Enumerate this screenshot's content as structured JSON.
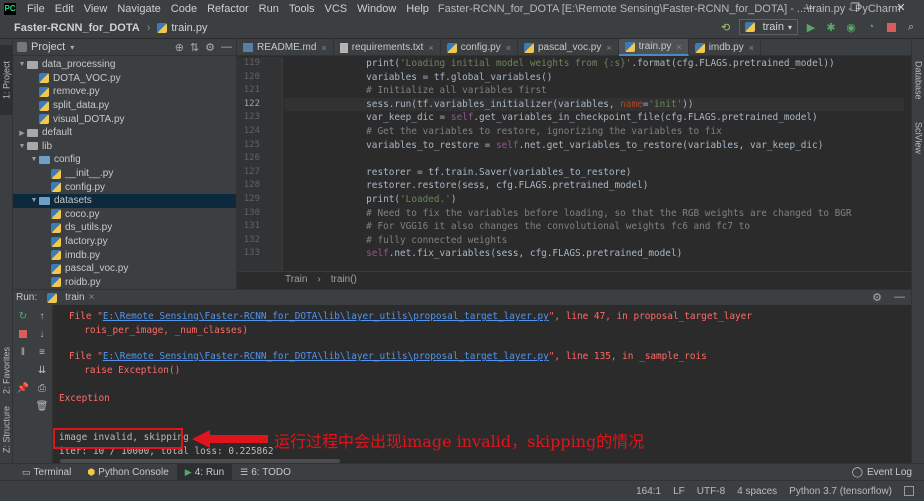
{
  "window": {
    "menu": [
      "File",
      "Edit",
      "View",
      "Navigate",
      "Code",
      "Refactor",
      "Run",
      "Tools",
      "VCS",
      "Window",
      "Help"
    ],
    "title": "Faster-RCNN_for_DOTA [E:\\Remote Sensing\\Faster-RCNN_for_DOTA] - ...\\train.py - PyCharm",
    "controls": [
      "—",
      "❐",
      "✕"
    ]
  },
  "navbar": {
    "project": "Faster-RCNN_for_DOTA",
    "file": "train.py",
    "run_config": "train"
  },
  "left_stripe": {
    "project_tab": "1: Project",
    "favorites_tab": "2: Favorites",
    "structure_tab": "Z: Structure"
  },
  "right_stripe": {
    "database_tab": "Database",
    "sciview_tab": "SciView"
  },
  "project_panel": {
    "title": "Project",
    "tree": [
      {
        "label": "data_processing",
        "type": "folder",
        "depth": 1,
        "expanded": true
      },
      {
        "label": "DOTA_VOC.py",
        "type": "py",
        "depth": 2
      },
      {
        "label": "remove.py",
        "type": "py",
        "depth": 2
      },
      {
        "label": "split_data.py",
        "type": "py",
        "depth": 2
      },
      {
        "label": "visual_DOTA.py",
        "type": "py",
        "depth": 2
      },
      {
        "label": "default",
        "type": "folder",
        "depth": 1,
        "expanded": false
      },
      {
        "label": "lib",
        "type": "folder",
        "depth": 1,
        "expanded": true
      },
      {
        "label": "config",
        "type": "folder",
        "depth": 2,
        "expanded": true
      },
      {
        "label": "__init__.py",
        "type": "py",
        "depth": 3
      },
      {
        "label": "config.py",
        "type": "py",
        "depth": 3
      },
      {
        "label": "datasets",
        "type": "folder",
        "depth": 2,
        "expanded": true,
        "selected": true
      },
      {
        "label": "coco.py",
        "type": "py",
        "depth": 3
      },
      {
        "label": "ds_utils.py",
        "type": "py",
        "depth": 3
      },
      {
        "label": "factory.py",
        "type": "py",
        "depth": 3
      },
      {
        "label": "imdb.py",
        "type": "py",
        "depth": 3
      },
      {
        "label": "pascal_voc.py",
        "type": "py",
        "depth": 3
      },
      {
        "label": "roidb.py",
        "type": "py",
        "depth": 3
      }
    ]
  },
  "editor": {
    "tabs": [
      {
        "label": "README.md",
        "icon": "markdown-icon"
      },
      {
        "label": "requirements.txt",
        "icon": "text-file-icon"
      },
      {
        "label": "config.py",
        "icon": "python-file-icon"
      },
      {
        "label": "pascal_voc.py",
        "icon": "python-file-icon"
      },
      {
        "label": "train.py",
        "icon": "python-file-icon",
        "active": true
      },
      {
        "label": "imdb.py",
        "icon": "python-file-icon"
      }
    ],
    "first_line": 119,
    "current_line": 122,
    "lines": [
      [
        [
          "plain",
          "        "
        ],
        [
          "plain",
          "print("
        ],
        [
          "str",
          "'Loading initial model weights from {:s}'"
        ],
        [
          "plain",
          ".format(cfg.FLAGS.pretrained_model))"
        ]
      ],
      [
        [
          "plain",
          "        variables = tf.global_variables()"
        ]
      ],
      [
        [
          "cmt",
          "        # Initialize all variables first"
        ]
      ],
      [
        [
          "plain",
          "        sess.run(tf.variables_initializer(variables, "
        ],
        [
          "prm",
          "name"
        ],
        [
          "plain",
          "="
        ],
        [
          "str",
          "'init'"
        ],
        [
          "plain",
          "))"
        ]
      ],
      [
        [
          "plain",
          "        var_keep_dic = "
        ],
        [
          "slf",
          "self"
        ],
        [
          "plain",
          ".get_variables_in_checkpoint_file(cfg.FLAGS.pretrained_model)"
        ]
      ],
      [
        [
          "cmt",
          "        # Get the variables to restore, ignorizing the variables to fix"
        ]
      ],
      [
        [
          "plain",
          "        variables_to_restore = "
        ],
        [
          "slf",
          "self"
        ],
        [
          "plain",
          ".net.get_variables_to_restore(variables, var_keep_dic)"
        ]
      ],
      [
        [
          "plain",
          ""
        ]
      ],
      [
        [
          "plain",
          "        restorer = tf.train.Saver(variables_to_restore)"
        ]
      ],
      [
        [
          "plain",
          "        restorer.restore(sess, cfg.FLAGS.pretrained_model)"
        ]
      ],
      [
        [
          "plain",
          "        print("
        ],
        [
          "str",
          "'Loaded.'"
        ],
        [
          "plain",
          ")"
        ]
      ],
      [
        [
          "cmt",
          "        # Need to fix the variables before loading, so that the RGB weights are changed to BGR"
        ]
      ],
      [
        [
          "cmt",
          "        # For VGG16 it also changes the convolutional weights fc6 and fc7 to"
        ]
      ],
      [
        [
          "cmt",
          "        # fully connected weights"
        ]
      ],
      [
        [
          "plain",
          "        "
        ],
        [
          "slf",
          "self"
        ],
        [
          "plain",
          ".net.fix_variables(sess, cfg.FLAGS.pretrained_model)"
        ]
      ]
    ],
    "breadcrumbs": [
      "Train",
      "train()"
    ]
  },
  "run_panel": {
    "label": "Run:",
    "tab": "train",
    "console": [
      {
        "kind": "error",
        "parts": [
          [
            "txt",
            "File \""
          ],
          [
            "lnk",
            "E:\\Remote Sensing\\Faster-RCNN_for_DOTA\\lib\\layer_utils\\proposal_target_layer.py"
          ],
          [
            "txt",
            "\", line 47, in proposal_target_layer"
          ]
        ]
      },
      {
        "kind": "error",
        "parts": [
          [
            "txt",
            "  rois_per_image, _num_classes)"
          ]
        ]
      },
      {
        "kind": "error",
        "parts": [
          [
            "txt",
            ""
          ]
        ]
      },
      {
        "kind": "error",
        "parts": [
          [
            "txt",
            "File \""
          ],
          [
            "lnk",
            "E:\\Remote Sensing\\Faster-RCNN_for_DOTA\\lib\\layer_utils\\proposal_target_layer.py"
          ],
          [
            "txt",
            "\", line 135, in _sample_rois"
          ]
        ]
      },
      {
        "kind": "error",
        "parts": [
          [
            "txt",
            "  raise Exception()"
          ]
        ]
      },
      {
        "kind": "error",
        "parts": [
          [
            "txt",
            ""
          ]
        ]
      },
      {
        "kind": "error",
        "parts": [
          [
            "txt",
            "Exception"
          ]
        ]
      },
      {
        "kind": "out",
        "parts": [
          [
            "txt",
            "image invalid, skipping"
          ]
        ]
      },
      {
        "kind": "out",
        "parts": [
          [
            "txt",
            "iter: 10 / 10000, total loss: 0.225862"
          ]
        ]
      }
    ],
    "annotation": "运行过程中会出现image invalid，skipping的情况"
  },
  "bottom_tools": {
    "items": [
      {
        "label": "Terminal",
        "icon": "terminal-icon"
      },
      {
        "label": "Python Console",
        "icon": "python-console-icon"
      },
      {
        "label": "4: Run",
        "icon": "run-icon",
        "active": true
      },
      {
        "label": "6: TODO",
        "icon": "todo-icon"
      }
    ],
    "event_log": "Event Log"
  },
  "status_bar": {
    "position": "164:1",
    "line_sep": "LF",
    "encoding": "UTF-8",
    "indent": "4 spaces",
    "interpreter": "Python 3.7 (tensorflow)"
  },
  "colors": {
    "accent": "#4a88c7",
    "error": "#ff6b68",
    "link": "#5394ec",
    "annotation": "#e0141c"
  }
}
